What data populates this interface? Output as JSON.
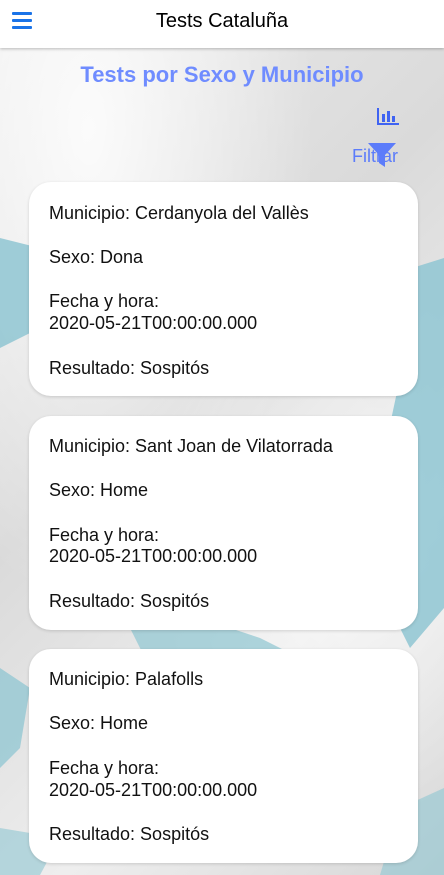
{
  "appbar": {
    "title": "Tests Cataluña",
    "menu_icon": "hamburger-menu-icon"
  },
  "page": {
    "title": "Tests por Sexo y Municipio",
    "chart_icon": "bar-chart-icon",
    "filter_label": "Filtrar",
    "filter_icon": "funnel-filter-icon"
  },
  "colors": {
    "accent": "#5c7cfa",
    "title": "#6f8cff",
    "menu": "#1a73e8",
    "map_water": "#8fc6d2"
  },
  "tests": [
    {
      "municipio": "Municipio: Cerdanyola del Vallès",
      "sexo": "Sexo: Dona",
      "fecha_label": "Fecha y hora:",
      "fecha_value": "2020-05-21T00:00:00.000",
      "resultado": "Resultado: Sospitós"
    },
    {
      "municipio": "Municipio: Sant Joan de Vilatorrada",
      "sexo": "Sexo: Home",
      "fecha_label": "Fecha y hora:",
      "fecha_value": "2020-05-21T00:00:00.000",
      "resultado": "Resultado: Sospitós"
    },
    {
      "municipio": "Municipio: Palafolls",
      "sexo": "Sexo: Home",
      "fecha_label": "Fecha y hora:",
      "fecha_value": "2020-05-21T00:00:00.000",
      "resultado": "Resultado: Sospitós"
    }
  ]
}
